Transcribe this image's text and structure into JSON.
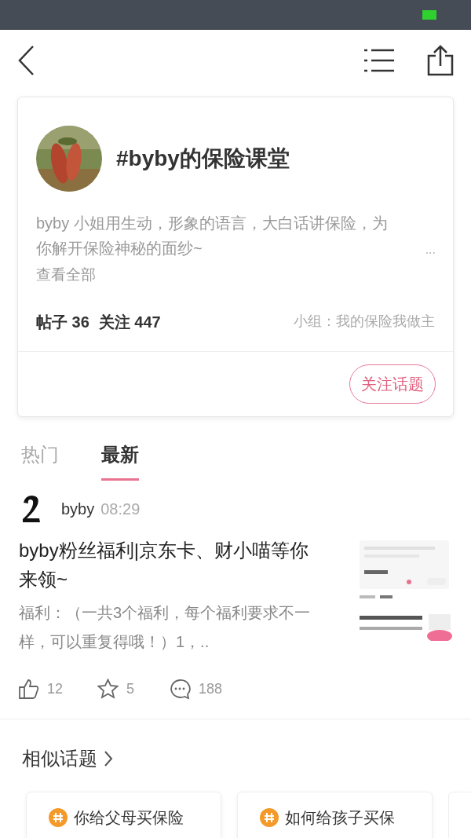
{
  "topic": {
    "title": "#byby的保险课堂",
    "description": "byby 小姐用生动，形象的语言，大白话讲保险，为你解开保险神秘的面纱~",
    "more_dots": "...",
    "more_link": "查看全部",
    "stats": [
      {
        "label": "帖子",
        "value": "36"
      },
      {
        "label": "关注",
        "value": "447"
      }
    ],
    "group": "小组：我的保险我做主",
    "follow_button": "关注话题"
  },
  "tabs": [
    {
      "label": "热门",
      "selected": false
    },
    {
      "label": "最新",
      "selected": true
    }
  ],
  "post": {
    "author": "byby",
    "time": "08:29",
    "title": "byby粉丝福利|京东卡、财小喵等你来领~",
    "excerpt": "福利：（一共3个福利，每个福利要求不一样，可以重复得哦！）1，..",
    "actions": [
      {
        "kind": "like",
        "count": "12"
      },
      {
        "kind": "star",
        "count": "5"
      },
      {
        "kind": "comment",
        "count": "188"
      }
    ]
  },
  "similar": {
    "title": "相似话题",
    "cards": [
      {
        "title": "你给父母买保险"
      },
      {
        "title": "如何给孩子买保"
      }
    ]
  }
}
